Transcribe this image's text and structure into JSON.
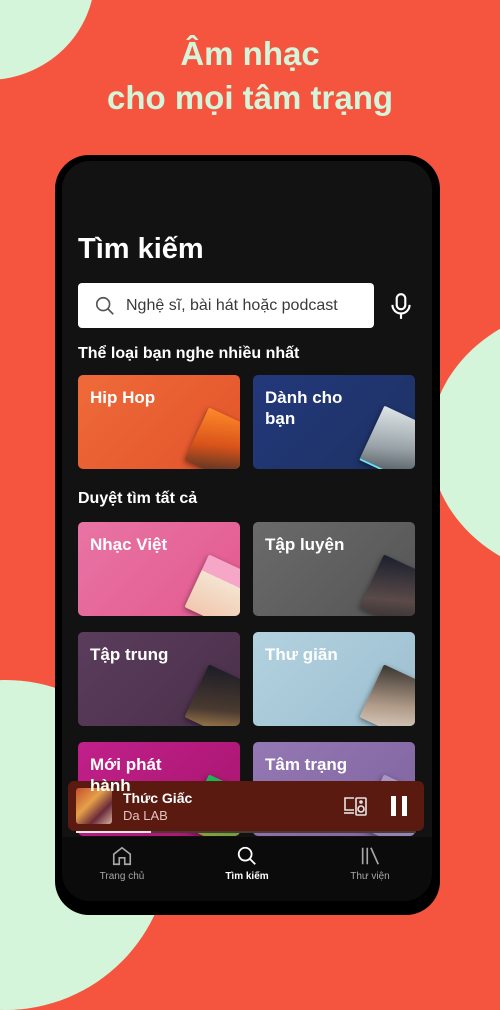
{
  "promo": {
    "headline_line1": "Âm nhạc",
    "headline_line2": "cho mọi tâm trạng",
    "background_color": "#f5553e",
    "accent_color": "#d5f5db"
  },
  "search_page": {
    "title": "Tìm kiếm",
    "search_placeholder": "Nghệ sĩ, bài hát hoặc podcast",
    "top_genres_title": "Thể loại bạn nghe nhiều nhất",
    "top_genres": [
      {
        "label": "Hip Hop",
        "color": "#e8562e"
      },
      {
        "label": "Dành cho bạn",
        "color": "#1e3264"
      }
    ],
    "browse_all_title": "Duyệt tìm tất cả",
    "browse_all": [
      {
        "label": "Nhạc Việt",
        "color": "#e8659a"
      },
      {
        "label": "Tập luyện",
        "color": "#5f5f5f"
      },
      {
        "label": "Tập trung",
        "color": "#503750"
      },
      {
        "label": "Thư giãn",
        "color": "#a9c8d8"
      },
      {
        "label": "Mới phát hành",
        "color": "#b01a7c"
      },
      {
        "label": "Tâm trạng",
        "color": "#8d67ab"
      }
    ]
  },
  "now_playing": {
    "track": "Thức Giấc",
    "artist": "Da LAB",
    "progress_percent": 22,
    "state": "playing"
  },
  "tabbar": {
    "items": [
      {
        "label": "Trang chủ",
        "icon": "home-icon",
        "active": false
      },
      {
        "label": "Tìm kiếm",
        "icon": "search-icon",
        "active": true
      },
      {
        "label": "Thư viện",
        "icon": "library-icon",
        "active": false
      }
    ]
  }
}
